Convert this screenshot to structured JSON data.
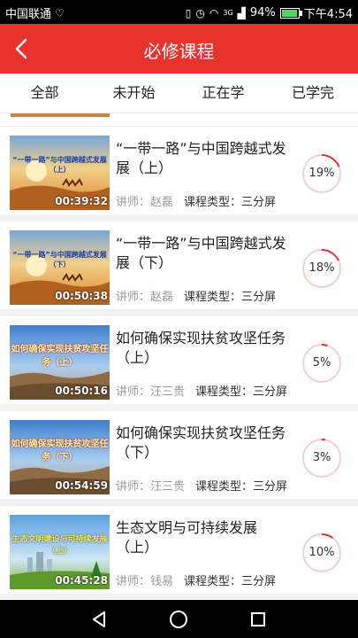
{
  "status_bar": {
    "carrier": "中国联通",
    "network": "3G",
    "battery": "94%",
    "battery_level": 0.94,
    "time": "下午4:54"
  },
  "header": {
    "title": "必修课程"
  },
  "tabs": [
    {
      "label": "全部",
      "active": false
    },
    {
      "label": "未开始",
      "active": false
    },
    {
      "label": "正在学",
      "active": true
    },
    {
      "label": "已学完",
      "active": false
    }
  ],
  "colors": {
    "brand": "#e8322e",
    "progress_track": "#f3d0d0"
  },
  "courses": [
    {
      "title": "“一带一路”与中国跨越式发展（上）",
      "thumb_text": "“一带一路”与中国跨越式发展（上）",
      "duration": "00:39:32",
      "teacher_label": "讲师：赵磊",
      "type_label": "课程类型：三分屏",
      "progress_text": "19%",
      "progress": 0.19
    },
    {
      "title": "“一带一路”与中国跨越式发展（下）",
      "thumb_text": "“一带一路”与中国跨越式发展（下）",
      "duration": "00:50:38",
      "teacher_label": "讲师：赵磊",
      "type_label": "课程类型：三分屏",
      "progress_text": "18%",
      "progress": 0.18
    },
    {
      "title": "如何确保实现扶贫攻坚任务（上）",
      "thumb_text": "如何确保实现扶贫攻坚任务（上）",
      "duration": "00:50:16",
      "teacher_label": "讲师：汪三贵",
      "type_label": "课程类型：三分屏",
      "progress_text": "5%",
      "progress": 0.05
    },
    {
      "title": "如何确保实现扶贫攻坚任务（下）",
      "thumb_text": "如何确保实现扶贫攻坚任务（下）",
      "duration": "00:54:59",
      "teacher_label": "讲师：汪三贵",
      "type_label": "课程类型：三分屏",
      "progress_text": "3%",
      "progress": 0.03
    },
    {
      "title": "生态文明与可持续发展（上）",
      "thumb_text": "生态文明建设与可持续发展（上）",
      "duration": "00:45:28",
      "teacher_label": "讲师：钱易",
      "type_label": "课程类型：三分屏",
      "progress_text": "10%",
      "progress": 0.1
    }
  ],
  "nav_bar": {
    "back_icon": "triangle-back-icon",
    "home_icon": "circle-home-icon",
    "recents_icon": "square-recents-icon"
  }
}
